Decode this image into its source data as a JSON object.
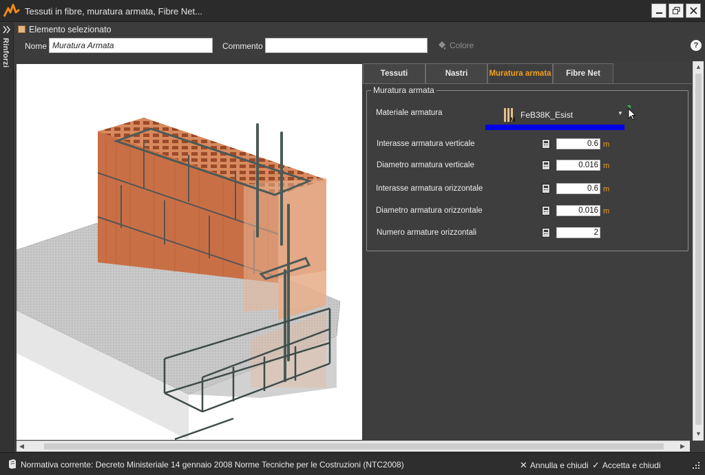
{
  "window": {
    "title": "Tessuti in fibre, muratura armata, Fibre Net...",
    "controls": [
      "minimize-icon",
      "restore-icon",
      "close-icon"
    ]
  },
  "sidebar": {
    "label": "Rinforzi",
    "icon": "double-chevron-icon"
  },
  "header": {
    "selected_label": "Elemento selezionato",
    "name_label": "Nome",
    "name_value": "Muratura Armata",
    "comment_label": "Commento",
    "comment_value": "",
    "color_label": "Colore",
    "help_label": "?"
  },
  "tabs": [
    {
      "label": "Tessuti",
      "active": false
    },
    {
      "label": "Nastri",
      "active": false
    },
    {
      "label": "Muratura armata",
      "active": true
    },
    {
      "label": "Fibre Net",
      "active": false
    }
  ],
  "group": {
    "title": "Muratura armata",
    "material": {
      "label": "Materiale armatura",
      "value": "FeB38K_Esist"
    },
    "fields": [
      {
        "label": "Interasse armatura verticale",
        "value": "0.6",
        "unit": "m"
      },
      {
        "label": "Diametro armatura verticale",
        "value": "0.016",
        "unit": "m"
      },
      {
        "label": "Interasse armatura orizzontale",
        "value": "0.6",
        "unit": "m"
      },
      {
        "label": "Diametro armatura orizzontale",
        "value": "0.016",
        "unit": "m"
      },
      {
        "label": "Numero armature orizzontali",
        "value": "2",
        "unit": ""
      }
    ]
  },
  "status": {
    "normativa": "Normativa corrente:  Decreto Ministeriale 14 gennaio 2008 Norme Tecniche per le Costruzioni (NTC2008)",
    "cancel_label": "Annulla e chiudi",
    "accept_label": "Accetta e chiudi"
  },
  "colors": {
    "accent": "#f0a020",
    "brick": "#c8714a",
    "highlight_bar": "#0000e6"
  }
}
